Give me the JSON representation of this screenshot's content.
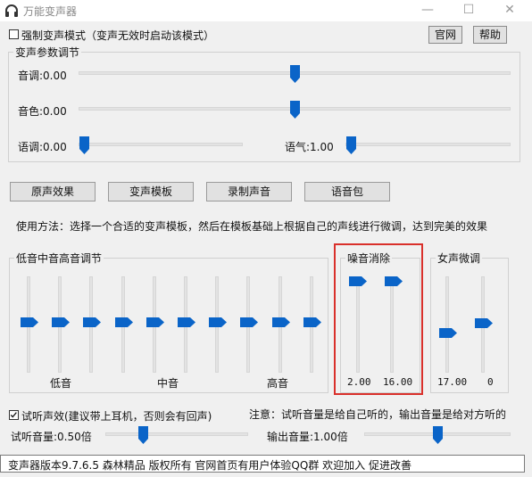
{
  "window": {
    "title": "万能变声器",
    "minimize": "—",
    "maximize": "☐",
    "close": "✕"
  },
  "top": {
    "force_mode_label": "强制变声模式（变声无效时启动该模式）",
    "official_btn": "官网",
    "help_btn": "帮助"
  },
  "params": {
    "group_title": "变声参数调节",
    "pitch_label": "音调:0.00",
    "timbre_label": "音色:0.00",
    "speed_label": "语调:0.00",
    "tone_label": "语气:1.00",
    "pitch_level": 0.5,
    "timbre_level": 0.5,
    "speed_level": 0.0,
    "tone_level": 0.0
  },
  "buttons": {
    "original": "原声效果",
    "template": "变声模板",
    "record": "录制声音",
    "voicepack": "语音包"
  },
  "usage_text": "使用方法：选择一个合适的变声模板，然后在模板基础上根据自己的声线进行微调，达到完美的效果",
  "eq": {
    "group_title": "低音中音高音调节",
    "low_label": "低音",
    "mid_label": "中音",
    "high_label": "高音"
  },
  "noise": {
    "group_title": "噪音消除",
    "value1": "2.00",
    "value2": "16.00"
  },
  "female": {
    "group_title": "女声微调",
    "value1": "17.00",
    "value2": "0"
  },
  "monitor": {
    "checkbox_label": "试听声效(建议带上耳机，否则会有回声)",
    "checked": true,
    "note": "注意：试听音量是给自己听的，输出音量是给对方听的",
    "listen_label": "试听音量:0.50倍",
    "output_label": "输出音量:1.00倍"
  },
  "status": {
    "text": "变声器版本9.7.6.5   森林精品 版权所有   官网首页有用户体验QQ群 欢迎加入 促进改善"
  },
  "colors": {
    "thumb": "#0a64c8",
    "red_highlight": "#d9302b"
  }
}
